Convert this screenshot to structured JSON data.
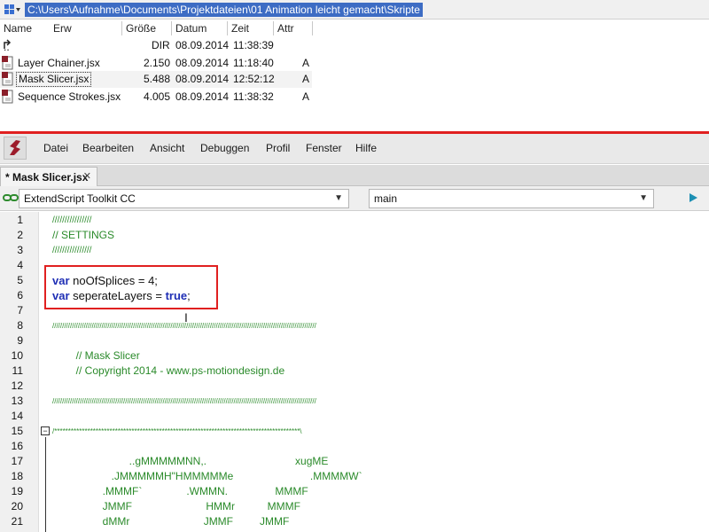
{
  "path_bar": {
    "path": "C:\\Users\\Aufnahme\\Documents\\Projektdateien\\01 Animation leicht gemacht\\Skripte"
  },
  "file_list": {
    "columns": {
      "name": "Name",
      "ext": "Erw",
      "size": "Größe",
      "date": "Datum",
      "time": "Zeit",
      "attr": "Attr"
    },
    "rows": [
      {
        "name": "..",
        "size": "DIR",
        "date": "08.09.2014",
        "time": "11:38:39",
        "attr": "",
        "icon": "parent-folder-icon"
      },
      {
        "name": "Layer Chainer.jsx",
        "size": "2.150",
        "date": "08.09.2014",
        "time": "11:18:40",
        "attr": "A",
        "icon": "jsx-file-icon"
      },
      {
        "name": "Mask Slicer.jsx",
        "size": "5.488",
        "date": "08.09.2014",
        "time": "12:52:12",
        "attr": "A",
        "icon": "jsx-file-icon",
        "selected": true
      },
      {
        "name": "Sequence Strokes.jsx",
        "size": "4.005",
        "date": "08.09.2014",
        "time": "11:38:32",
        "attr": "A",
        "icon": "jsx-file-icon"
      }
    ]
  },
  "menu": {
    "items": [
      "Datei",
      "Bearbeiten",
      "Ansicht",
      "Debuggen",
      "Profil",
      "Fenster",
      "Hilfe"
    ]
  },
  "tab": {
    "label": "* Mask Slicer.jsx",
    "close": "✕"
  },
  "target": {
    "app": "ExtendScript Toolkit CC",
    "engine": "main"
  },
  "editor": {
    "line_numbers": [
      "1",
      "2",
      "3",
      "4",
      "5",
      "6",
      "7",
      "8",
      "9",
      "10",
      "11",
      "12",
      "13",
      "14",
      "15",
      "16",
      "17",
      "18",
      "19",
      "20",
      "21"
    ],
    "lines": {
      "l1": "////////////////",
      "l2": "// SETTINGS",
      "l3": "////////////////",
      "l5_kw": "var",
      "l5_rest": " noOfSplices = ",
      "l5_val": "4",
      "l5_end": ";",
      "l6_kw": "var",
      "l6_rest": " seperateLayers = ",
      "l6_val": "true",
      "l6_end": ";",
      "l8": "//////////////////////////////////////////////////////////////////////////////////////////////////////////////////////////////////////",
      "l10": "        // Mask Slicer",
      "l11": "        // Copyright 2014 - www.ps-motiondesign.de",
      "l13": "//////////////////////////////////////////////////////////////////////////////////////////////////////////////////////////////////////",
      "l15": "/*****************************************************************************************\\",
      "l17": "                          ..gMMMMMNN,.                              xugME",
      "l18": "                    .JMMMMMH\"HMMMMMe                          .MMMMW`",
      "l19": "                 .MMMF`               .WMMN.                MMMF",
      "l20": "                 JMMF                         HMMr           MMMF",
      "l21": "                 dMMr                         JMMF         JMMF"
    }
  },
  "colors": {
    "path_highlight": "#3d6cc4",
    "divider_red": "#e02020",
    "comment_green": "#2a8a2a",
    "keyword_blue": "#1f2fb5"
  }
}
